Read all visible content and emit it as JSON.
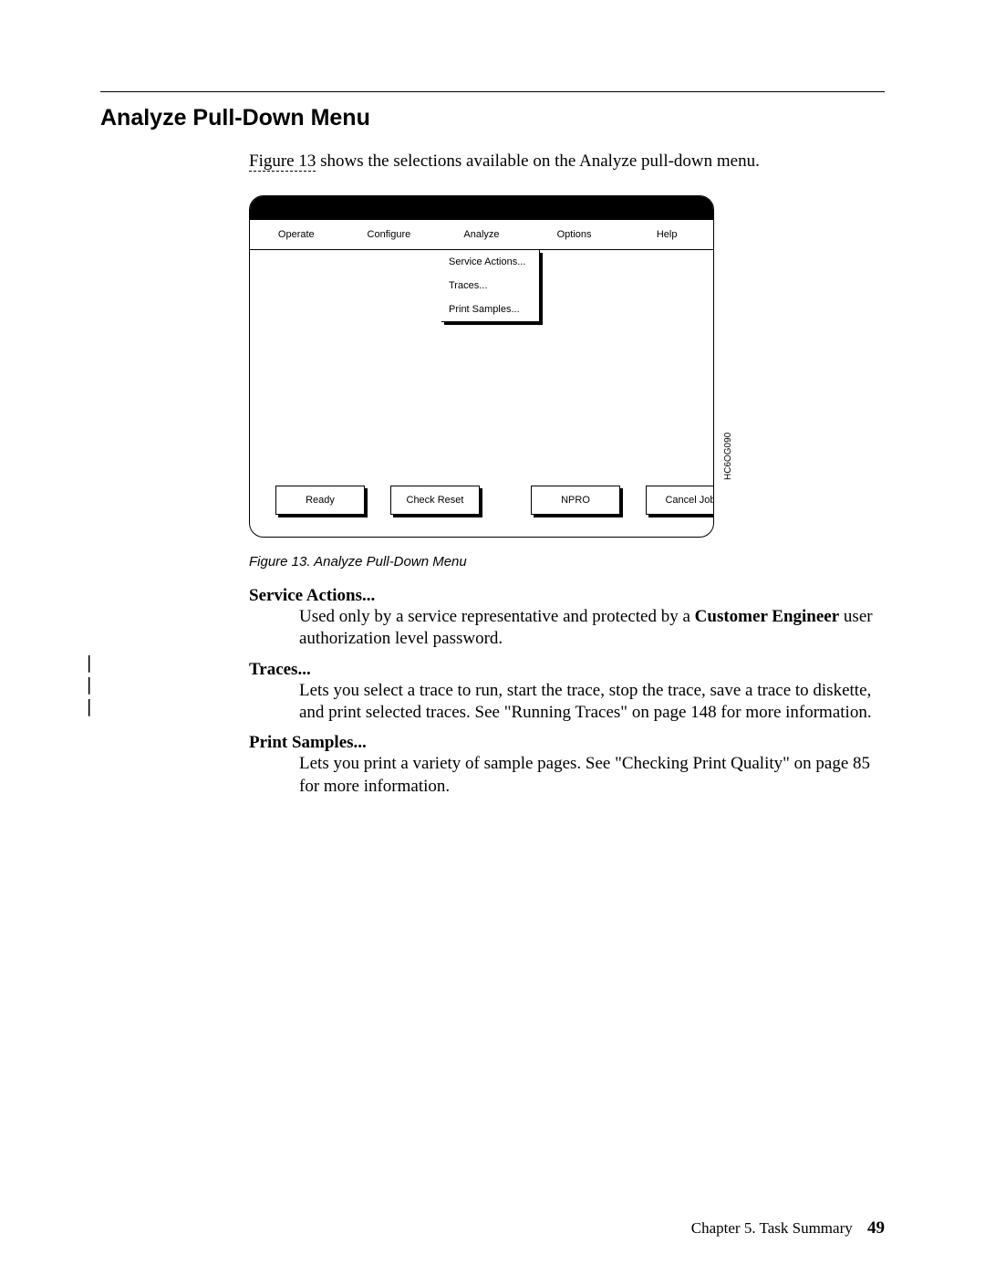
{
  "heading": "Analyze Pull-Down Menu",
  "intro_link": "Figure 13",
  "intro_rest": " shows the selections available on the Analyze pull-down menu.",
  "menubar": {
    "operate": "Operate",
    "configure": "Configure",
    "analyze": "Analyze",
    "options": "Options",
    "help": "Help"
  },
  "pulldown": {
    "service_actions": "Service Actions...",
    "traces": "Traces...",
    "print_samples": "Print Samples..."
  },
  "buttons": {
    "ready": "Ready",
    "check_reset": "Check Reset",
    "npro": "NPRO",
    "cancel_job": "Cancel Job"
  },
  "side_code": "HC6OG090",
  "figure_caption": "Figure 13. Analyze Pull-Down Menu",
  "definitions": {
    "service_actions": {
      "term": "Service Actions...",
      "body_1": "Used only by a service representative and protected by a ",
      "body_bold": "Customer Engineer",
      "body_2": " user authorization level password."
    },
    "traces": {
      "term": "Traces...",
      "body": "Lets you select a trace to run, start the trace, stop the trace, save a trace to diskette, and print selected traces. See \"Running Traces\" on page 148 for more information."
    },
    "print_samples": {
      "term": "Print Samples...",
      "body": "Lets you print a variety of sample pages. See \"Checking Print Quality\" on page 85 for more information."
    }
  },
  "footer": {
    "chapter": "Chapter 5. Task Summary",
    "page": "49"
  },
  "change_bar": "|"
}
